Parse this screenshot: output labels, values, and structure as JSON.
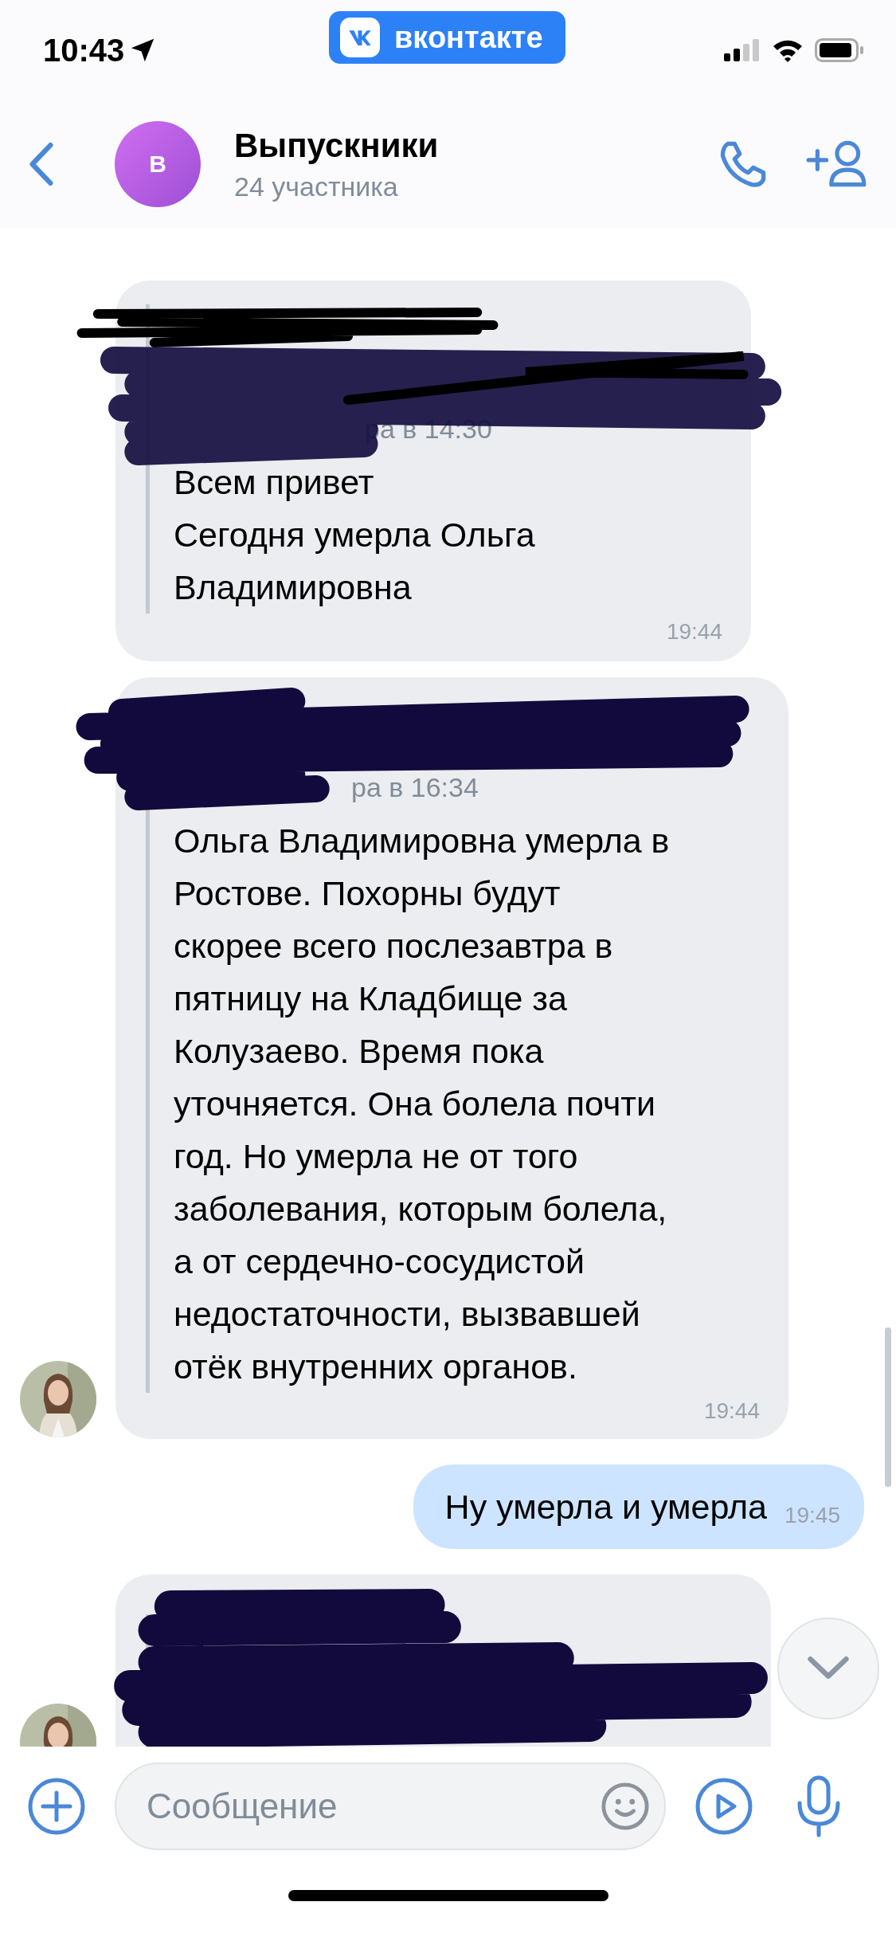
{
  "status_bar": {
    "time": "10:43",
    "app_badge": "вконтакте"
  },
  "header": {
    "avatar_letter": "В",
    "title": "Выпускники",
    "subtitle": "24 участника"
  },
  "messages": [
    {
      "kind": "forwarded",
      "outgoing": false,
      "avatar": false,
      "forward_time": "ра в 14:30",
      "text": "Всем привет\nСегодня умерла Ольга\nВладимировна",
      "time": "19:44"
    },
    {
      "kind": "forwarded",
      "outgoing": false,
      "avatar": true,
      "forward_time": "ра в 16:34",
      "text": "Ольга Владимировна умерла в\nРостове. Похорны будут\nскорее всего послезавтра в\nпятницу на Кладбище за\nКолузаево. Время пока\nуточняется. Она болела почти\nгод. Но умерла не от того\nзаболевания, которым болела,\nа от сердечно-сосудистой\nнедостаточности, вызвавшей\nотёк внутренних органов.",
      "time": "19:44"
    },
    {
      "kind": "plain",
      "outgoing": true,
      "avatar": false,
      "text": "Ну умерла и умерла",
      "time": "19:45"
    },
    {
      "kind": "redacted",
      "outgoing": false,
      "avatar": true
    }
  ],
  "composer": {
    "placeholder": "Сообщение"
  }
}
